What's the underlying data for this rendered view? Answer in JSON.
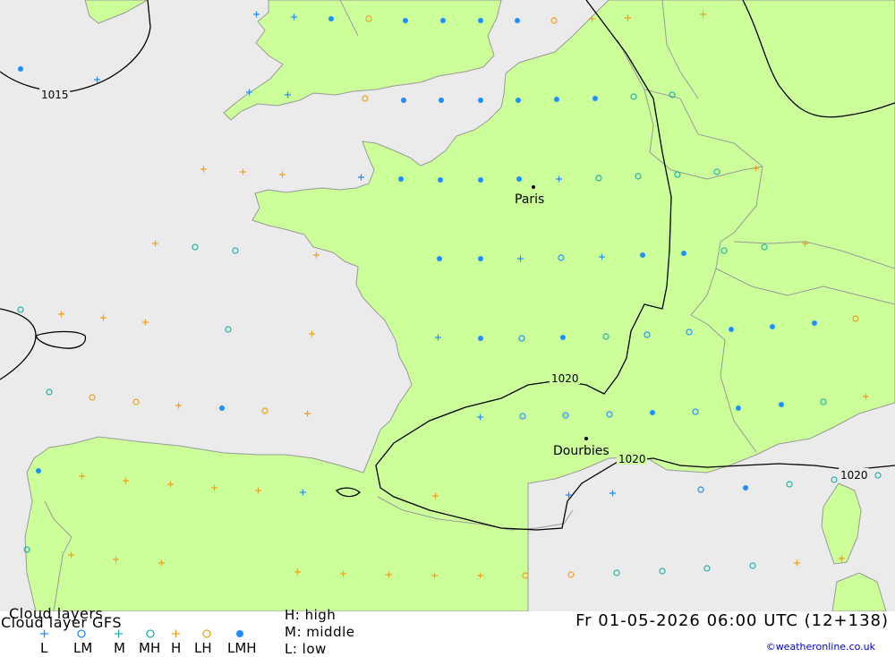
{
  "header": {
    "title": "Cloud layers",
    "subtitle": "Cloud layer  GFS",
    "datetime": "Fr 01-05-2026 06:00 UTC (12+138)",
    "credit": "©weatheronline.co.uk"
  },
  "legend": {
    "items": [
      {
        "label": "L",
        "symbol": "plus",
        "color": "#1e90ff"
      },
      {
        "label": "LM",
        "symbol": "circle",
        "color": "#1e90ff"
      },
      {
        "label": "M",
        "symbol": "plus",
        "color": "#20b2aa"
      },
      {
        "label": "MH",
        "symbol": "circle",
        "color": "#20b2aa"
      },
      {
        "label": "H",
        "symbol": "plus",
        "color": "#f0a020"
      },
      {
        "label": "LH",
        "symbol": "circle",
        "color": "#f0a020"
      },
      {
        "label": "LMH",
        "symbol": "dot",
        "color": "#1e90ff"
      }
    ],
    "levels": [
      {
        "text": "H:  high"
      },
      {
        "text": "M:  middle"
      },
      {
        "text": "L:  low"
      }
    ]
  },
  "map": {
    "colors": {
      "sea": "#ebebeb",
      "land": "#ccff99",
      "border": "#999999",
      "isobar": "#000000"
    },
    "cities": [
      {
        "name": "Paris"
      },
      {
        "name": "Dourbies"
      }
    ],
    "isobar_labels": [
      {
        "text": "1015"
      },
      {
        "text": "1020"
      },
      {
        "text": "1020"
      },
      {
        "text": "1020"
      }
    ]
  }
}
